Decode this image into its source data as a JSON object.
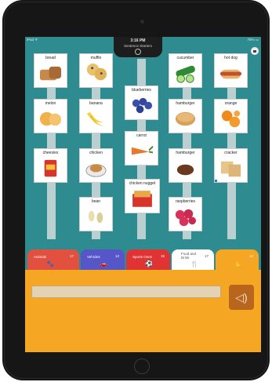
{
  "status": {
    "left": "iPad ᯤ",
    "right": "76% ▭"
  },
  "header": {
    "time": "3:16 PM",
    "title": "Sentence Starters"
  },
  "cards": [
    {
      "label": "bread"
    },
    {
      "label": "muffin"
    },
    {
      "label": "blueberries"
    },
    {
      "label": "cucumber"
    },
    {
      "label": "hot dog"
    },
    {
      "label": "melon"
    },
    {
      "label": "banana"
    },
    {
      "label": "carrot"
    },
    {
      "label": "hamburger"
    },
    {
      "label": "orange"
    },
    {
      "label": "cheesies"
    },
    {
      "label": "chicken"
    },
    {
      "label": "chicken nugget"
    },
    {
      "label": "hamburger"
    },
    {
      "label": "cracker"
    },
    {
      "label": "bean"
    },
    {
      "label": "raspberries"
    }
  ],
  "tabs": [
    {
      "label": "Animals",
      "count": "17",
      "icon": "paw-icon",
      "color": "#e2503f"
    },
    {
      "label": "Vehicles",
      "count": "12",
      "icon": "car-icon",
      "color": "#5656c8"
    },
    {
      "label": "Sports Ones",
      "count": "15",
      "icon": "ball-icon",
      "color": "#e03434"
    },
    {
      "label": "Food and Drink",
      "count": "17",
      "icon": "utensils-icon",
      "color": "#ffffff"
    },
    {
      "label": "",
      "count": "12",
      "icon": "hand-icon",
      "color": "#f5a623"
    }
  ],
  "colors": {
    "board": "#2e8b8f",
    "tray": "#f5a623",
    "speak": "#b8661e"
  }
}
